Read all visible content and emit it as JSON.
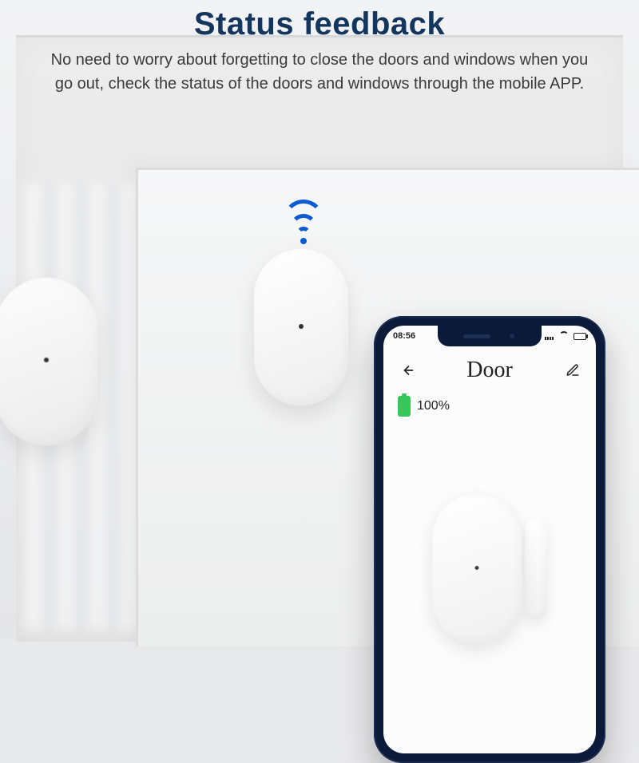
{
  "marketing": {
    "title": "Status feedback",
    "description": "No need to worry about forgetting to close the doors and windows when you go out, check the status of the doors and windows through the mobile APP."
  },
  "phone": {
    "statusbar": {
      "time": "08:56"
    },
    "app": {
      "title": "Door",
      "battery_percent": "100%"
    }
  }
}
